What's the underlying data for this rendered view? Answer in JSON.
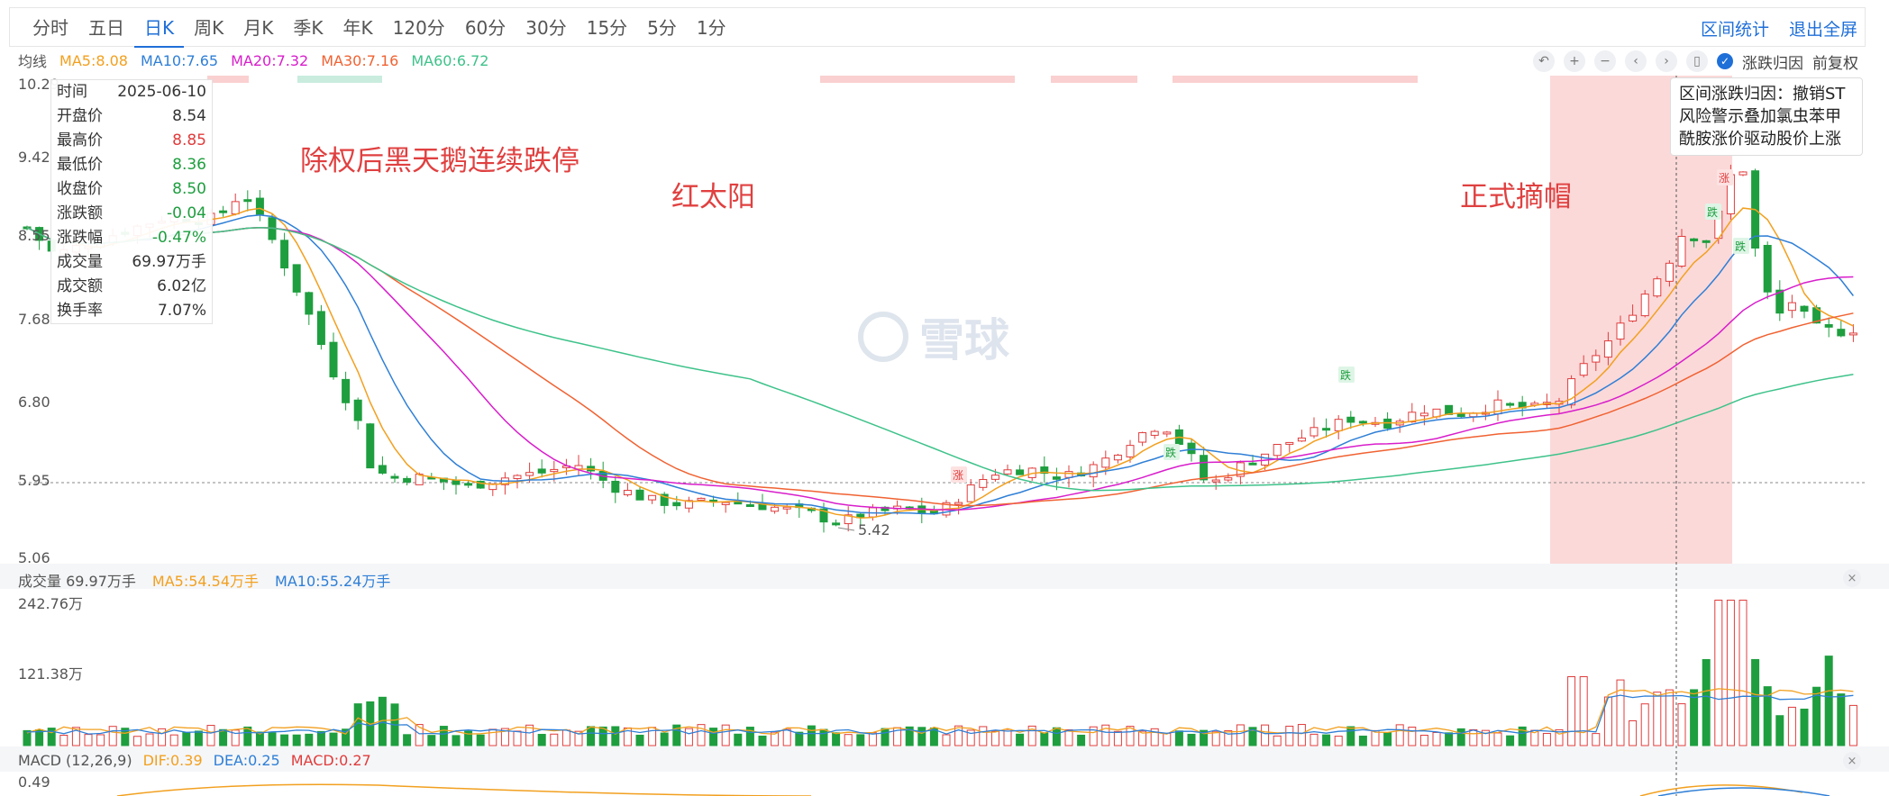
{
  "tabs": [
    "分时",
    "五日",
    "日K",
    "周K",
    "月K",
    "季K",
    "年K",
    "120分",
    "60分",
    "30分",
    "15分",
    "5分",
    "1分"
  ],
  "active_tab": "日K",
  "links": {
    "interval_stats": "区间统计",
    "exit_fullscreen": "退出全屏"
  },
  "ma": {
    "label": "均线",
    "items": [
      {
        "text": "MA5:8.08",
        "color": "#f2a01f"
      },
      {
        "text": "MA10:7.65",
        "color": "#2f7fd6"
      },
      {
        "text": "MA20:7.32",
        "color": "#d81ecb"
      },
      {
        "text": "MA30:7.16",
        "color": "#f06232"
      },
      {
        "text": "MA60:6.72",
        "color": "#3ec28a"
      }
    ]
  },
  "toolbar": {
    "reason_label": "涨跌归因",
    "adjust_label": "前复权"
  },
  "price_axis": [
    "10.29",
    "9.42",
    "8.55",
    "7.68",
    "6.80",
    "5.95",
    "5.06"
  ],
  "low_marker": "5.42",
  "tooltip": [
    {
      "label": "时间",
      "value": "2025-06-10",
      "color": "#333333"
    },
    {
      "label": "开盘价",
      "value": "8.54",
      "color": "#333333"
    },
    {
      "label": "最高价",
      "value": "8.85",
      "color": "#e03c3c"
    },
    {
      "label": "最低价",
      "value": "8.36",
      "color": "#1e9e3f"
    },
    {
      "label": "收盘价",
      "value": "8.50",
      "color": "#1e9e3f"
    },
    {
      "label": "涨跌额",
      "value": "-0.04",
      "color": "#1e9e3f"
    },
    {
      "label": "涨跌幅",
      "value": "-0.47%",
      "color": "#1e9e3f"
    },
    {
      "label": "成交量",
      "value": "69.97万手",
      "color": "#333333"
    },
    {
      "label": "成交额",
      "value": "6.02亿",
      "color": "#333333"
    },
    {
      "label": "换手率",
      "value": "7.07%",
      "color": "#333333"
    }
  ],
  "annotations": {
    "a1": "除权后黑天鹅连续跌停",
    "a2": "红太阳",
    "a3": "正式摘帽"
  },
  "cause": {
    "text": "区间涨跌归因：撤销ST风险警示叠加氯虫苯甲酰胺涨价驱动股价上涨"
  },
  "badges": {
    "up": "涨",
    "down": "跌"
  },
  "watermark": "雪球",
  "volume": {
    "label": "成交量 69.97万手",
    "ma5": "MA5:54.54万手",
    "ma10": "MA10:55.24万手",
    "axis": [
      "242.76万",
      "121.38万"
    ]
  },
  "macd": {
    "label": "MACD (12,26,9)",
    "dif": "DIF:0.39",
    "dea": "DEA:0.25",
    "macd": "MACD:0.27",
    "axis_top": "0.49"
  },
  "colors": {
    "up": "#e03c3c",
    "down": "#1e9e3f",
    "accent": "#1f6fd8"
  }
}
